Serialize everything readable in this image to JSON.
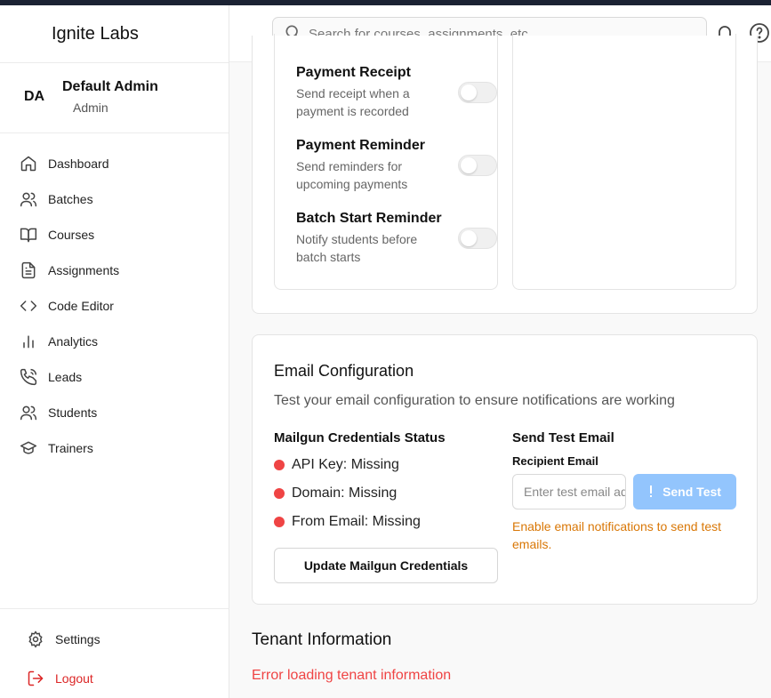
{
  "app": {
    "brand": "Ignite Labs"
  },
  "user": {
    "initials": "DA",
    "name": "Default Admin",
    "role": "Admin"
  },
  "sidebar": {
    "items": [
      {
        "label": "Dashboard",
        "icon": "home-icon"
      },
      {
        "label": "Batches",
        "icon": "users-icon"
      },
      {
        "label": "Courses",
        "icon": "book-icon"
      },
      {
        "label": "Assignments",
        "icon": "file-text-icon"
      },
      {
        "label": "Code Editor",
        "icon": "code-icon"
      },
      {
        "label": "Analytics",
        "icon": "bar-chart-icon"
      },
      {
        "label": "Leads",
        "icon": "phone-icon"
      },
      {
        "label": "Students",
        "icon": "users-icon"
      },
      {
        "label": "Trainers",
        "icon": "graduation-cap-icon"
      }
    ],
    "bottom": {
      "settings": "Settings",
      "logout": "Logout"
    }
  },
  "header": {
    "search_placeholder": "Search for courses, assignments, etc."
  },
  "notifications": {
    "toggles": [
      {
        "title": "Payment Receipt",
        "desc": "Send receipt when a payment is recorded",
        "enabled": false
      },
      {
        "title": "Payment Reminder",
        "desc": "Send reminders for upcoming payments",
        "enabled": false
      },
      {
        "title": "Batch Start Reminder",
        "desc": "Notify students before batch starts",
        "enabled": false
      }
    ]
  },
  "email_config": {
    "title": "Email Configuration",
    "description": "Test your email configuration to ensure notifications are working",
    "mailgun_title": "Mailgun Credentials Status",
    "statuses": [
      {
        "label": "API Key: Missing"
      },
      {
        "label": "Domain: Missing"
      },
      {
        "label": "From Email: Missing"
      }
    ],
    "update_button": "Update Mailgun Credentials",
    "send_test_title": "Send Test Email",
    "recipient_label": "Recipient Email",
    "recipient_placeholder": "Enter test email address",
    "send_button": "Send Test",
    "warning": "Enable email notifications to send test emails."
  },
  "tenant": {
    "title": "Tenant Information",
    "error": "Error loading tenant information"
  },
  "colors": {
    "accent_blue_disabled": "#93c5fd",
    "error_red": "#ef4444",
    "warning_orange": "#d97706"
  }
}
